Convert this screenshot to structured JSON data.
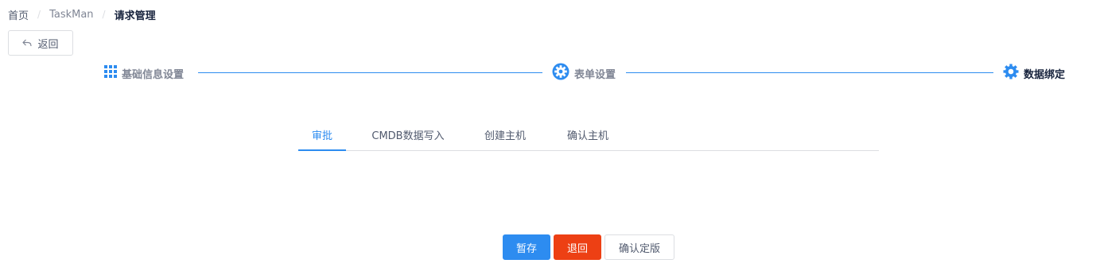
{
  "breadcrumb": {
    "home": "首页",
    "app": "TaskMan",
    "current": "请求管理",
    "separator": "/"
  },
  "back_button": {
    "label": "返回",
    "icon": "reply-icon"
  },
  "steps": [
    {
      "label": "基础信息设置",
      "icon": "grid-icon",
      "status": "done"
    },
    {
      "label": "表单设置",
      "icon": "gear-icon",
      "status": "current"
    },
    {
      "label": "数据绑定",
      "icon": "gear-icon",
      "status": "wait"
    }
  ],
  "tabs": {
    "items": [
      "审批",
      "CMDB数据写入",
      "创建主机",
      "确认主机"
    ],
    "active_index": 0
  },
  "actions": {
    "save_draft": "暂存",
    "reject": "退回",
    "confirm_version": "确认定版"
  },
  "colors": {
    "primary": "#2d8cf0",
    "error": "#ed4014",
    "text": "#515a6e",
    "border": "#dcdee2"
  }
}
